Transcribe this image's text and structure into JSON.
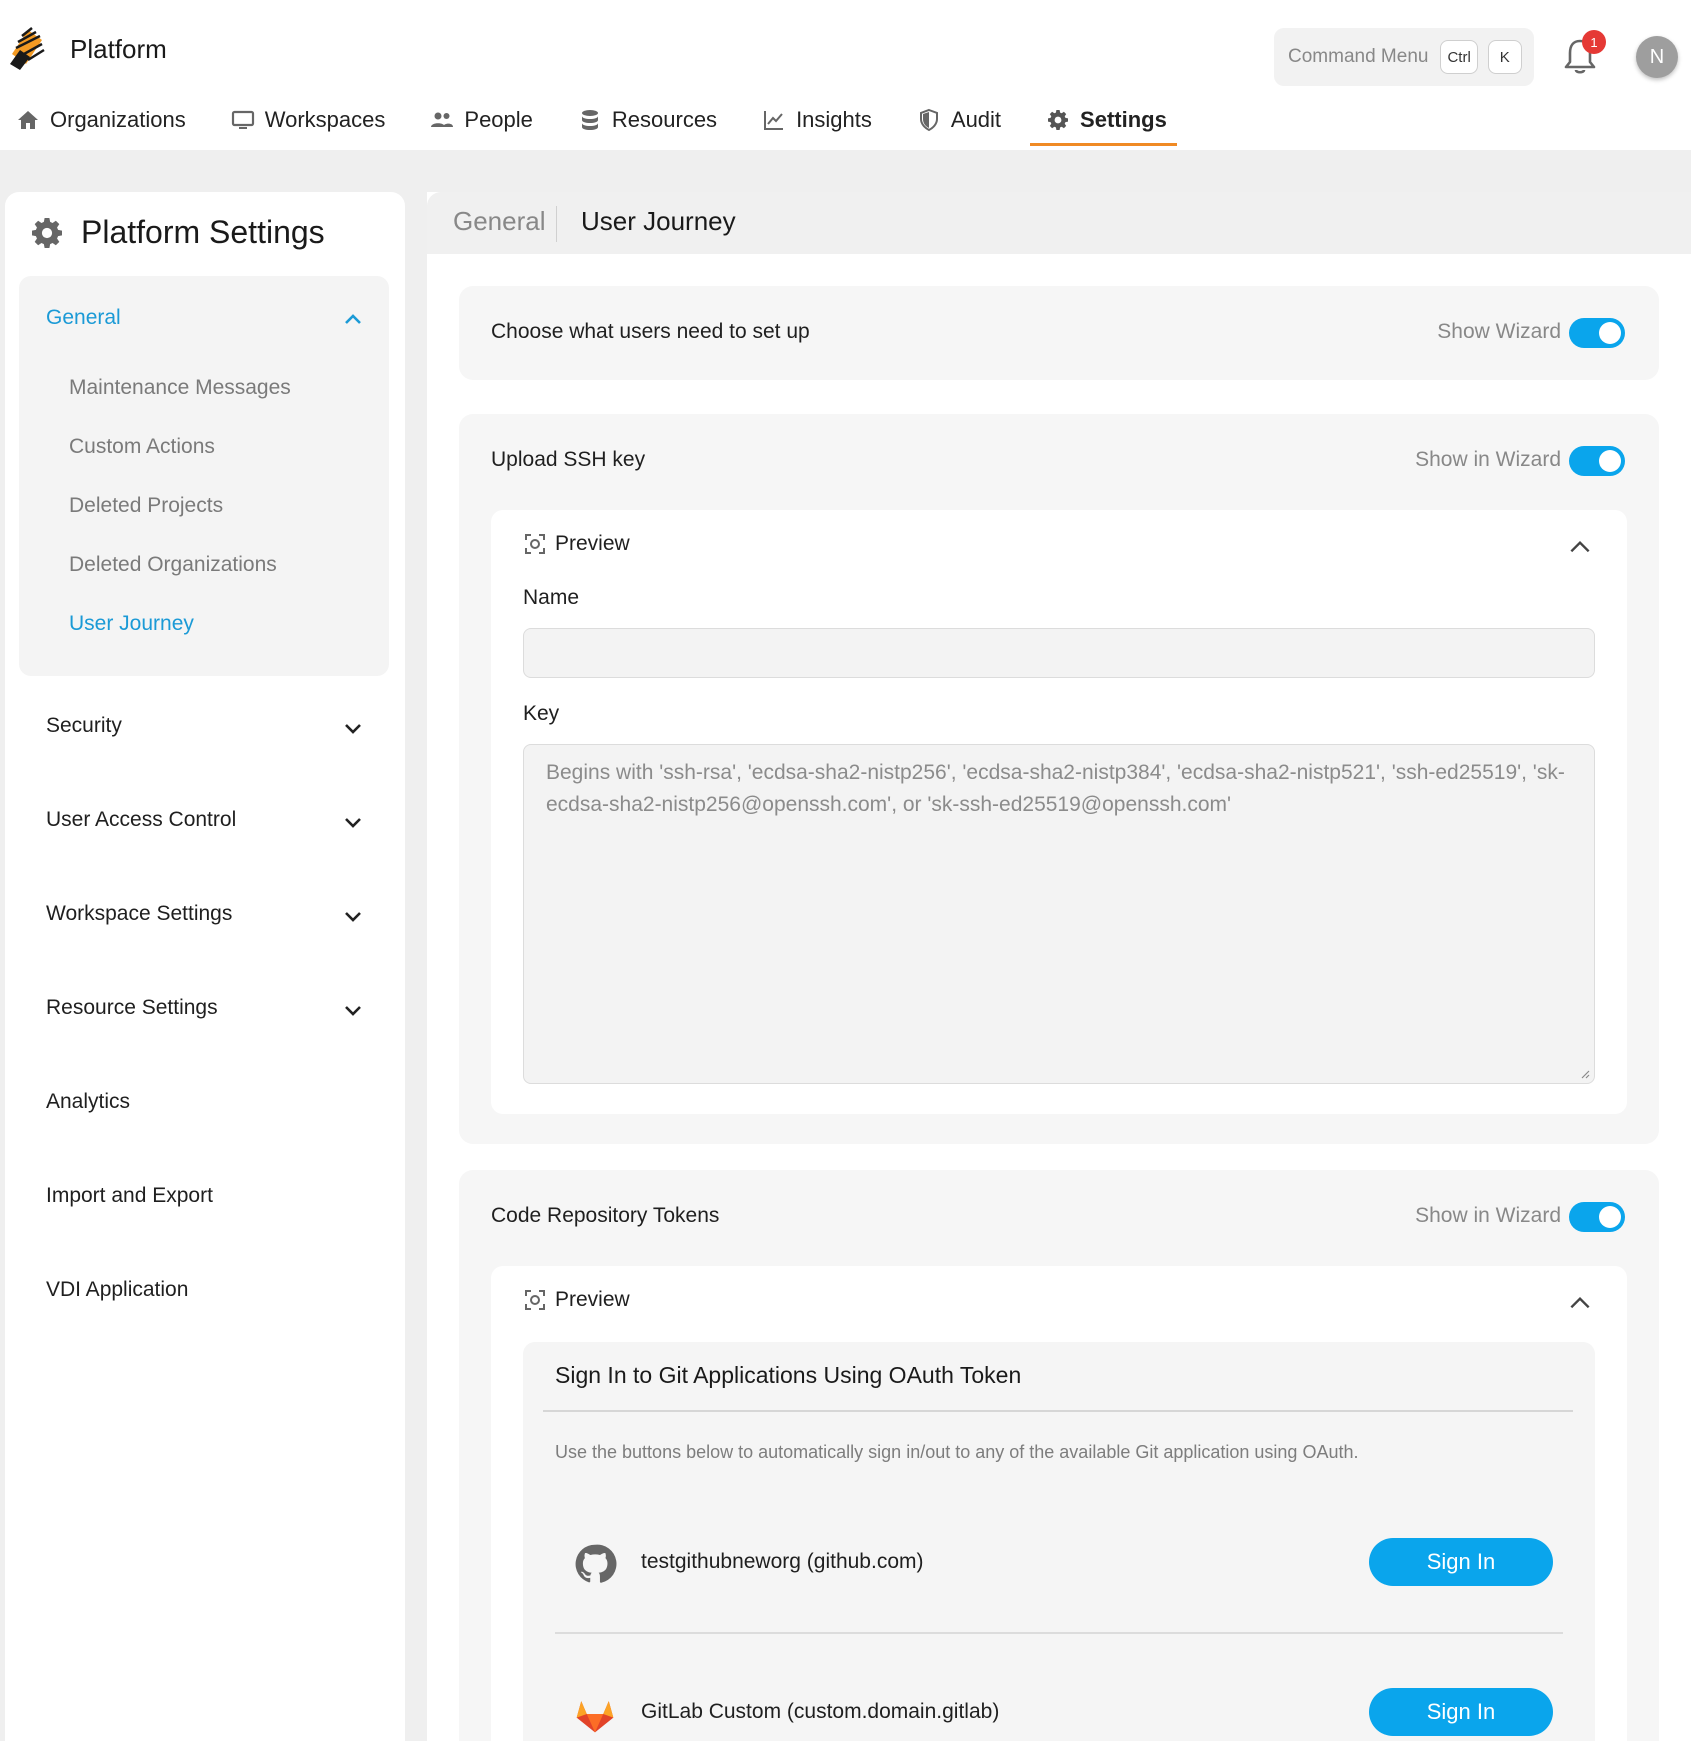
{
  "app": {
    "title": "Platform",
    "command_menu": {
      "label": "Command Menu",
      "key1": "Ctrl",
      "key2": "K"
    },
    "notifications_count": "1",
    "avatar_initial": "N",
    "accent_color": "#0aa5ec",
    "nav_underline_color": "#f08a24"
  },
  "nav": [
    {
      "label": "Organizations",
      "icon": "home-icon"
    },
    {
      "label": "Workspaces",
      "icon": "monitor-icon"
    },
    {
      "label": "People",
      "icon": "people-icon"
    },
    {
      "label": "Resources",
      "icon": "database-icon"
    },
    {
      "label": "Insights",
      "icon": "chart-icon"
    },
    {
      "label": "Audit",
      "icon": "shield-icon"
    },
    {
      "label": "Settings",
      "icon": "gear-icon",
      "active": true
    }
  ],
  "sidebar": {
    "title": "Platform Settings",
    "general": {
      "label": "General",
      "items": [
        "Maintenance Messages",
        "Custom Actions",
        "Deleted Projects",
        "Deleted Organizations",
        "User Journey"
      ]
    },
    "sections": [
      "Security",
      "User Access Control",
      "Workspace Settings",
      "Resource Settings",
      "Analytics",
      "Import and Export",
      "VDI Application"
    ]
  },
  "tabs": {
    "general": "General",
    "current": "User Journey"
  },
  "cards": {
    "setup": {
      "label": "Choose what users need to set up",
      "toggle_label": "Show Wizard",
      "toggle_on": true
    },
    "ssh": {
      "label": "Upload SSH key",
      "toggle_label": "Show in Wizard",
      "toggle_on": true,
      "preview_label": "Preview",
      "name_label": "Name",
      "key_label": "Key",
      "key_placeholder": "Begins with 'ssh-rsa', 'ecdsa-sha2-nistp256', 'ecdsa-sha2-nistp384', 'ecdsa-sha2-nistp521', 'ssh-ed25519', 'sk-ecdsa-sha2-nistp256@openssh.com', or 'sk-ssh-ed25519@openssh.com'"
    },
    "tokens": {
      "label": "Code Repository Tokens",
      "toggle_label": "Show in Wizard",
      "toggle_on": true,
      "preview_label": "Preview",
      "git_title": "Sign In to Git Applications Using OAuth Token",
      "git_desc": "Use the buttons below to automatically sign in/out to any of the available Git application using OAuth.",
      "providers": [
        {
          "name": "testgithubneworg (github.com)",
          "icon": "github-icon",
          "button": "Sign In"
        },
        {
          "name": "GitLab Custom (custom.domain.gitlab)",
          "icon": "gitlab-icon",
          "button": "Sign In"
        }
      ]
    }
  }
}
